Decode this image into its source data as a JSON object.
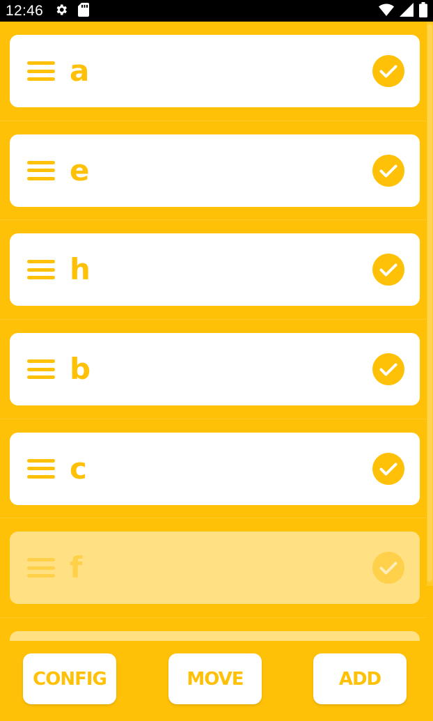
{
  "status_bar": {
    "time": "12:46",
    "left_icons": [
      "settings-icon",
      "sd-card-icon"
    ],
    "right_icons": [
      "wifi-icon",
      "signal-icon",
      "battery-icon"
    ]
  },
  "colors": {
    "accent": "#FFC107",
    "card": "#FFFFFF",
    "card_faded": "#FFE082",
    "status_bar": "#000000"
  },
  "items": [
    {
      "label": "a",
      "checked": true,
      "faded": false
    },
    {
      "label": "e",
      "checked": true,
      "faded": false
    },
    {
      "label": "h",
      "checked": true,
      "faded": false
    },
    {
      "label": "b",
      "checked": true,
      "faded": false
    },
    {
      "label": "c",
      "checked": true,
      "faded": false
    },
    {
      "label": "f",
      "checked": true,
      "faded": true
    }
  ],
  "bottom_bar": {
    "config_label": "CONFIG",
    "move_label": "MOVE",
    "add_label": "ADD"
  }
}
